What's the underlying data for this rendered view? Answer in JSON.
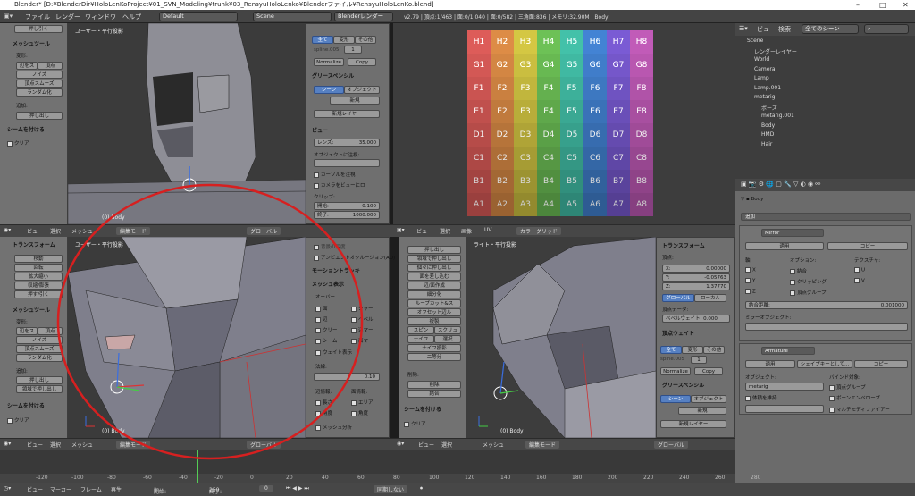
{
  "titlebar": {
    "title": "Blender* [D:¥BlenderDir¥HoloLenKoProject¥01_SVN_Modeling¥trunk¥03_RensyuHoloLenko¥Blenderファイル¥RensyuHoloLenKo.blend]",
    "min": "–",
    "max": "□",
    "close": "✕"
  },
  "menubar": {
    "file": "ファイル",
    "render": "レンダー",
    "window": "ウィンドウ",
    "help": "ヘルプ",
    "layout": "Default",
    "scene": "Scene",
    "engine": "Blenderレンダー",
    "stats": "v2.79 | 頂点:1/463 | 面:0/1,040 | 面:0/582 | 三角面:836 | メモリ:32.90M | Body"
  },
  "left_tool_top": {
    "pull": "押し引く",
    "section": "メッシュツール",
    "deform": "変形:",
    "slide_edge": "辺をス",
    "vert": "頂点",
    "noise": "ノイズ",
    "smooth": "頂点スムーズ",
    "randomize": "ランダム化",
    "add": "追加:",
    "extrude": "押し出し",
    "scene_section": "シームを付ける",
    "clear": "クリア"
  },
  "vp1": {
    "label": "ユーザー・平行投影",
    "bottom": "(0) Body"
  },
  "props1": {
    "tab_all": "全て",
    "tab_changed": "変形",
    "tab_other": "その他",
    "spline": "spline.005",
    "spline_val": "1",
    "normalize": "Normalize",
    "copy": "Copy",
    "grease": "グリースペンシル",
    "scene": "シーン",
    "object": "オブジェクト",
    "new": "新規",
    "new_layer": "新規レイヤー",
    "view": "ビュー",
    "lens": "レンズ:",
    "lens_val": "35.000",
    "lock_obj": "オブジェクトに注視:",
    "lock_cursor": "カーソルを注視",
    "lock_cam": "カメラをビューにロ",
    "clip": "クリップ:",
    "clip_start": "開始:",
    "clip_start_val": "0.100",
    "clip_end": "終了:",
    "clip_end_val": "1000.000"
  },
  "uvgrid": {
    "rows": [
      [
        "H1",
        "H2",
        "H3",
        "H4",
        "H5",
        "H6",
        "H7",
        "H8"
      ],
      [
        "G1",
        "G2",
        "G3",
        "G4",
        "G5",
        "G6",
        "G7",
        "G8"
      ],
      [
        "F1",
        "F2",
        "F3",
        "F4",
        "F5",
        "F6",
        "F7",
        "F8"
      ],
      [
        "E1",
        "E2",
        "E3",
        "E4",
        "E5",
        "E6",
        "E7",
        "E8"
      ],
      [
        "D1",
        "D2",
        "D3",
        "D4",
        "D5",
        "D6",
        "D7",
        "D8"
      ],
      [
        "C1",
        "C2",
        "C3",
        "C4",
        "C5",
        "C6",
        "C7",
        "C8"
      ],
      [
        "B1",
        "B2",
        "B3",
        "B4",
        "B5",
        "B6",
        "B7",
        "B8"
      ],
      [
        "A1",
        "A2",
        "A3",
        "A4",
        "A5",
        "A6",
        "A7",
        "A8"
      ]
    ],
    "colors": [
      "#c0504d",
      "#c07a3d",
      "#b8ad3a",
      "#5fa84b",
      "#3aa893",
      "#3a72b8",
      "#6a4fb8",
      "#a84fa0"
    ]
  },
  "vheader": {
    "view": "ビュー",
    "select": "選択",
    "mesh": "メッシュ",
    "mode": "編集モード",
    "global": "グローバル",
    "image": "画像",
    "uv": "UV",
    "colorgrid": "カラーグリッド"
  },
  "left_tool_bottom": {
    "transform": "トランスフォーム",
    "move": "移動",
    "rotate": "回転",
    "scale": "拡大縮小",
    "shrink": "収縮/膨張",
    "push": "押す/引く",
    "mesh_tools": "メッシュツール",
    "deform": "変形:",
    "slide_edge": "辺をス",
    "vert": "頂点",
    "noise": "ノイズ",
    "smooth": "頂点スムーズ",
    "randomize": "ランダム化",
    "add": "追加:",
    "extrude": "押し出し",
    "extrude_region": "領域で押し出し",
    "seam": "シームを付ける",
    "clear": "クリア"
  },
  "vp2": {
    "label": "ユーザー・平行投影",
    "bottom": "(0) Body"
  },
  "props2": {
    "bg": "背景の深度",
    "ao": "アンビエントオクルージョン(AO)",
    "motion": "モーショントラッキ",
    "mesh_display": "メッシュ表示",
    "overlay": "オーバー",
    "face": "面",
    "seam": "シャー",
    "edge": "辺",
    "sharp": "ベベル",
    "crease": "クリー",
    "edge_marks": "辺マー",
    "seams": "シーム",
    "face_marks": "面マー",
    "weight": "ウェイト表示",
    "normals": "法線:",
    "size": "0.10",
    "edge_info": "辺情報:",
    "face_info": "面情報:",
    "length": "長さ",
    "area": "エリア",
    "angle": "角度",
    "angle2": "角度",
    "mesh_analysis": "メッシュ分析"
  },
  "mid_tools": {
    "extrude": "押し出し",
    "extrude_region": "領域で押し出し",
    "extrude_indiv": "個々に押し出し",
    "inset": "面を差し込む",
    "edge_make": "辺/面作成",
    "subdivide": "細分化",
    "loop_cut": "ループカット&ス",
    "offset_edge": "オフセット辺ル",
    "duplicate": "複製",
    "spin": "スピン",
    "screw": "スクリュ",
    "knife": "ナイフ",
    "select": "選択",
    "knife_project": "ナイフ投影",
    "bisect": "二等分",
    "delete": "削除:",
    "delete_btn": "削除",
    "merge": "結合",
    "seam": "シームを付ける",
    "clear": "クリア"
  },
  "vp3": {
    "label": "ライト・平行投影",
    "bottom": "(0) Body"
  },
  "npanel": {
    "transform": "トランスフォーム",
    "vertex": "頂点:",
    "x": "X:",
    "x_val": "0.00000",
    "y": "Y:",
    "y_val": "-0.05763",
    "z": "Z:",
    "z_val": "1.37770",
    "global": "グローバル",
    "local": "ローカル",
    "vertex_data": "頂点データ:",
    "bevel": "ベベルウェイト:",
    "bevel_val": "0.000",
    "vertex_weight": "頂点ウェイト",
    "all": "全て",
    "deform": "変形",
    "other": "その他",
    "spline": "spine.005",
    "spline_val": "1",
    "normalize": "Normalize",
    "copy": "Copy",
    "grease": "グリースペンシル",
    "scene": "シーン",
    "object": "オブジェクト",
    "new": "新規",
    "new_layer": "新規レイヤー"
  },
  "outliner": {
    "view": "ビュー",
    "search": "検索",
    "all_scenes": "全てのシーン",
    "items": [
      "Scene",
      "レンダーレイヤー",
      "World",
      "Camera",
      "Lamp",
      "Lamp.001",
      "metarig",
      "ポーズ",
      "metarig.001",
      "Body",
      "HMD",
      "Hair"
    ]
  },
  "properties": {
    "object": "Body",
    "add": "追加",
    "mirror": "Mirror",
    "apply": "適用",
    "copy": "コピー",
    "axis": "軸:",
    "options": "オプション:",
    "texture": "テクスチャ:",
    "x": "X",
    "y": "Y",
    "z": "Z",
    "merge": "結合",
    "clipping": "クリッピング",
    "vertex_groups": "頂点グループ",
    "u": "U",
    "v": "V",
    "merge_limit": "結合距離:",
    "merge_limit_val": "0.001000",
    "mirror_object": "ミラーオブジェクト:",
    "armature": "Armature",
    "apply2": "適用",
    "shape_key": "シェイプキーとして...",
    "copy2": "コピー",
    "object_lbl": "オブジェクト:",
    "bind_to": "バインド対象:",
    "metarig": "metarig",
    "preserve_volume": "体積を維持",
    "vgroups": "頂点グループ",
    "bone_env": "ボーンエンベロープ",
    "multi_mod": "マルチモディファイアー"
  },
  "timeline": {
    "ticks": [
      "-120",
      "-100",
      "-80",
      "-60",
      "-40",
      "-20",
      "0",
      "20",
      "40",
      "60",
      "80",
      "100",
      "120",
      "140",
      "160",
      "180",
      "200",
      "220",
      "240",
      "260",
      "280"
    ],
    "view": "ビュー",
    "marker": "マーカー",
    "frame": "フレーム",
    "play": "再生",
    "start": "開始:",
    "start_val": "1",
    "end": "終了:",
    "end_val": "250",
    "current": "0",
    "sync": "同期しない"
  }
}
